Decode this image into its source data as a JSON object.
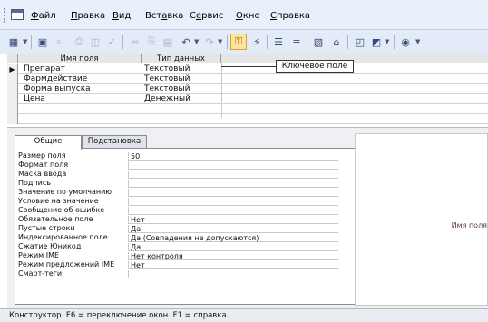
{
  "menu": {
    "items": [
      {
        "pre": "",
        "ul": "Ф",
        "post": "айл"
      },
      {
        "pre": "",
        "ul": "П",
        "post": "равка"
      },
      {
        "pre": "",
        "ul": "В",
        "post": "ид"
      },
      {
        "pre": "Вст",
        "ul": "а",
        "post": "вка"
      },
      {
        "pre": "С",
        "ul": "е",
        "post": "рвис"
      },
      {
        "pre": "",
        "ul": "О",
        "post": "кно"
      },
      {
        "pre": "",
        "ul": "С",
        "post": "правка"
      }
    ]
  },
  "grid": {
    "headers": {
      "name": "Имя поля",
      "type": "Тип данных"
    },
    "current_marker": "▶",
    "rows": [
      {
        "name": "Препарат",
        "type": "Текстовый"
      },
      {
        "name": "Фармдействие",
        "type": "Текстовый"
      },
      {
        "name": "Форма выпуска",
        "type": "Текстовый"
      },
      {
        "name": "Цена",
        "type": "Денежный"
      }
    ]
  },
  "callout": {
    "label": "Ключевое поле"
  },
  "properties": {
    "tabs": [
      "Общие",
      "Подстановка"
    ],
    "rows": [
      {
        "label": "Размер поля",
        "value": "50"
      },
      {
        "label": "Формат поля",
        "value": ""
      },
      {
        "label": "Маска ввода",
        "value": ""
      },
      {
        "label": "Подпись",
        "value": ""
      },
      {
        "label": "Значение по умолчанию",
        "value": ""
      },
      {
        "label": "Условие на значение",
        "value": ""
      },
      {
        "label": "Сообщение об ошибке",
        "value": ""
      },
      {
        "label": "Обязательное поле",
        "value": "Нет"
      },
      {
        "label": "Пустые строки",
        "value": "Да"
      },
      {
        "label": "Индексированное поле",
        "value": "Да (Совпадения не допускаются)"
      },
      {
        "label": "Сжатие Юникод",
        "value": "Да"
      },
      {
        "label": "Режим IME",
        "value": "Нет контроля"
      },
      {
        "label": "Режим предложений IME",
        "value": "Нет"
      },
      {
        "label": "Смарт-теги",
        "value": ""
      }
    ],
    "hint": "Имя поля"
  },
  "status": {
    "text": "Конструктор.  F6 = переключение окон.  F1 = справка."
  }
}
